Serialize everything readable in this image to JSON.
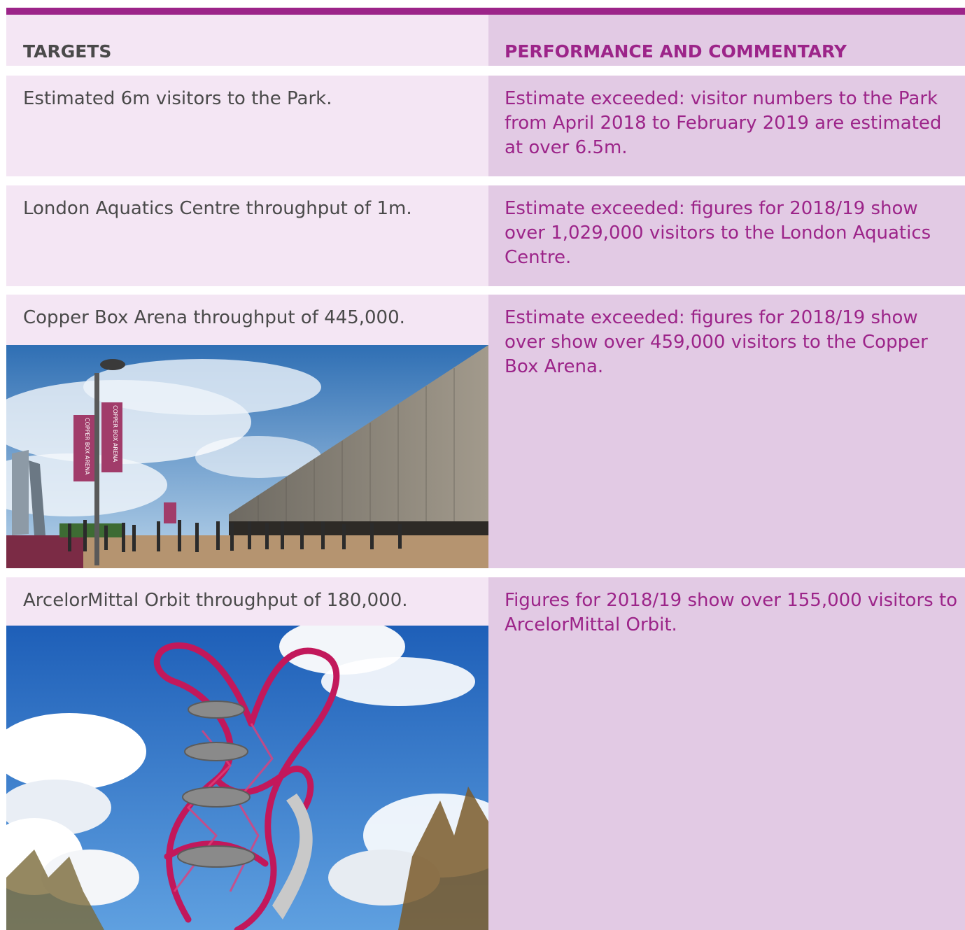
{
  "header": {
    "targets_label": "TARGETS",
    "performance_label": "PERFORMANCE AND COMMENTARY"
  },
  "rows": [
    {
      "target": "Estimated 6m visitors to the Park.",
      "performance": "Estimate exceeded: visitor numbers to the Park from April 2018 to February 2019 are estimated at over 6.5m."
    },
    {
      "target": "London Aquatics Centre throughput of 1m.",
      "performance": "Estimate exceeded: figures for 2018/19 show over 1,029,000 visitors to the London Aquatics Centre."
    },
    {
      "target": "Copper Box Arena throughput of  445,000.",
      "performance": "Estimate exceeded: figures for 2018/19 show over show over 459,000 visitors to the Copper Box Arena."
    },
    {
      "target": "ArcelorMittal Orbit throughput of 180,000.",
      "performance": "Figures for 2018/19 show over 155,000 visitors to ArcelorMittal Orbit."
    }
  ],
  "photos": {
    "copper_box_banner": "COPPER BOX ARENA"
  },
  "colors": {
    "accent": "#9c2489",
    "left_bg": "#f4e6f4",
    "right_bg": "#e2cae4",
    "text": "#4a4a4a"
  }
}
